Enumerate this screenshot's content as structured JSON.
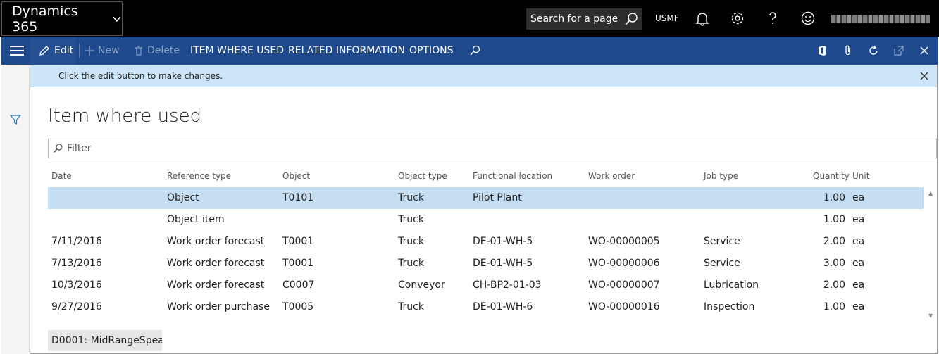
{
  "topbar": {
    "app_title": "Dynamics 365",
    "search_placeholder": "Search for a page",
    "company": "USMF",
    "user_name": ""
  },
  "actions": {
    "edit": "Edit",
    "new": "New",
    "delete": "Delete",
    "item_where_used": "ITEM WHERE USED",
    "related_information": "RELATED INFORMATION",
    "options": "OPTIONS"
  },
  "message": "Click the edit button to make changes.",
  "page_title": "Item where used",
  "filter_placeholder": "Filter",
  "columns": [
    "Date",
    "Reference type",
    "Object",
    "Object type",
    "Functional location",
    "Work order",
    "Job type",
    "Quantity",
    "Unit"
  ],
  "rows": [
    {
      "date": "",
      "ref": "Object",
      "object": "T0101",
      "otype": "Truck",
      "floc": "Pilot Plant",
      "wo": "",
      "job": "",
      "qty": "1.00",
      "unit": "ea"
    },
    {
      "date": "",
      "ref": "Object item",
      "object": "",
      "otype": "Truck",
      "floc": "",
      "wo": "",
      "job": "",
      "qty": "1.00",
      "unit": "ea"
    },
    {
      "date": "7/11/2016",
      "ref": "Work order forecast",
      "object": "T0001",
      "otype": "Truck",
      "floc": "DE-01-WH-5",
      "wo": "WO-00000005",
      "job": "Service",
      "qty": "2.00",
      "unit": "ea"
    },
    {
      "date": "7/13/2016",
      "ref": "Work order forecast",
      "object": "T0001",
      "otype": "Truck",
      "floc": "DE-01-WH-5",
      "wo": "WO-00000006",
      "job": "Service",
      "qty": "3.00",
      "unit": "ea"
    },
    {
      "date": "10/3/2016",
      "ref": "Work order forecast",
      "object": "C0007",
      "otype": "Conveyor",
      "floc": "CH-BP2-01-03",
      "wo": "WO-00000007",
      "job": "Lubrication",
      "qty": "2.00",
      "unit": "ea"
    },
    {
      "date": "9/27/2016",
      "ref": "Work order purchase",
      "object": "T0005",
      "otype": "Truck",
      "floc": "DE-01-WH-6",
      "wo": "WO-00000016",
      "job": "Inspection",
      "qty": "1.00",
      "unit": "ea"
    }
  ],
  "footer_tab": "D0001: MidRangeSpea...",
  "colors": {
    "nav_bg": "#000000",
    "action_bg": "#1e4a8d",
    "message_bg": "#cde6f7",
    "selected_row": "#c6def2"
  }
}
